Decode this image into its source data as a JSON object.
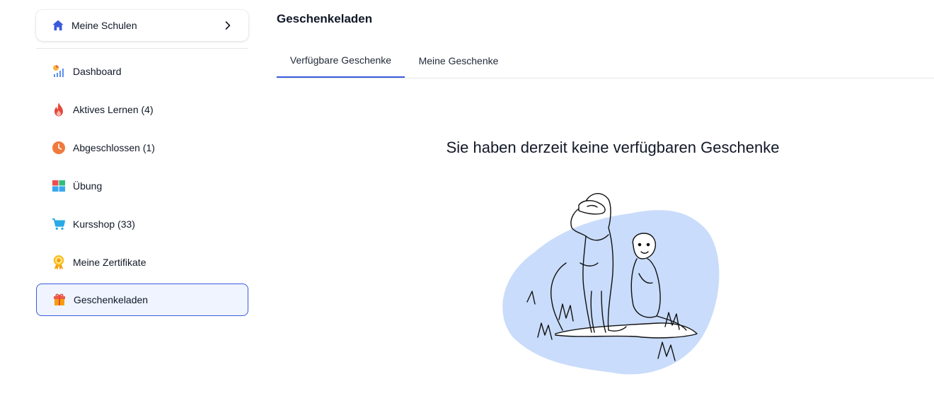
{
  "sidebar": {
    "school_selector": {
      "label": "Meine Schulen"
    },
    "items": [
      {
        "label": "Dashboard",
        "icon": "dashboard-chart-icon"
      },
      {
        "label": "Aktives Lernen (4)",
        "icon": "flame-icon"
      },
      {
        "label": "Abgeschlossen (1)",
        "icon": "clock-icon"
      },
      {
        "label": "Übung",
        "icon": "grid-blocks-icon"
      },
      {
        "label": "Kursshop (33)",
        "icon": "cart-icon"
      },
      {
        "label": "Meine Zertifikate",
        "icon": "certificate-badge-icon"
      },
      {
        "label": "Geschenkeladen",
        "icon": "gift-icon",
        "active": true
      }
    ]
  },
  "main": {
    "title": "Geschenkeladen",
    "tabs": [
      {
        "label": "Verfügbare Geschenke",
        "active": true
      },
      {
        "label": "Meine Geschenke",
        "active": false
      }
    ],
    "empty_state": {
      "message": "Sie haben derzeit keine verfügbaren Geschenke",
      "illustration": "meerkats-illustration"
    }
  },
  "colors": {
    "accent": "#3b5bdb",
    "active_bg": "#eff4ff",
    "blob": "#c9dcfb"
  }
}
